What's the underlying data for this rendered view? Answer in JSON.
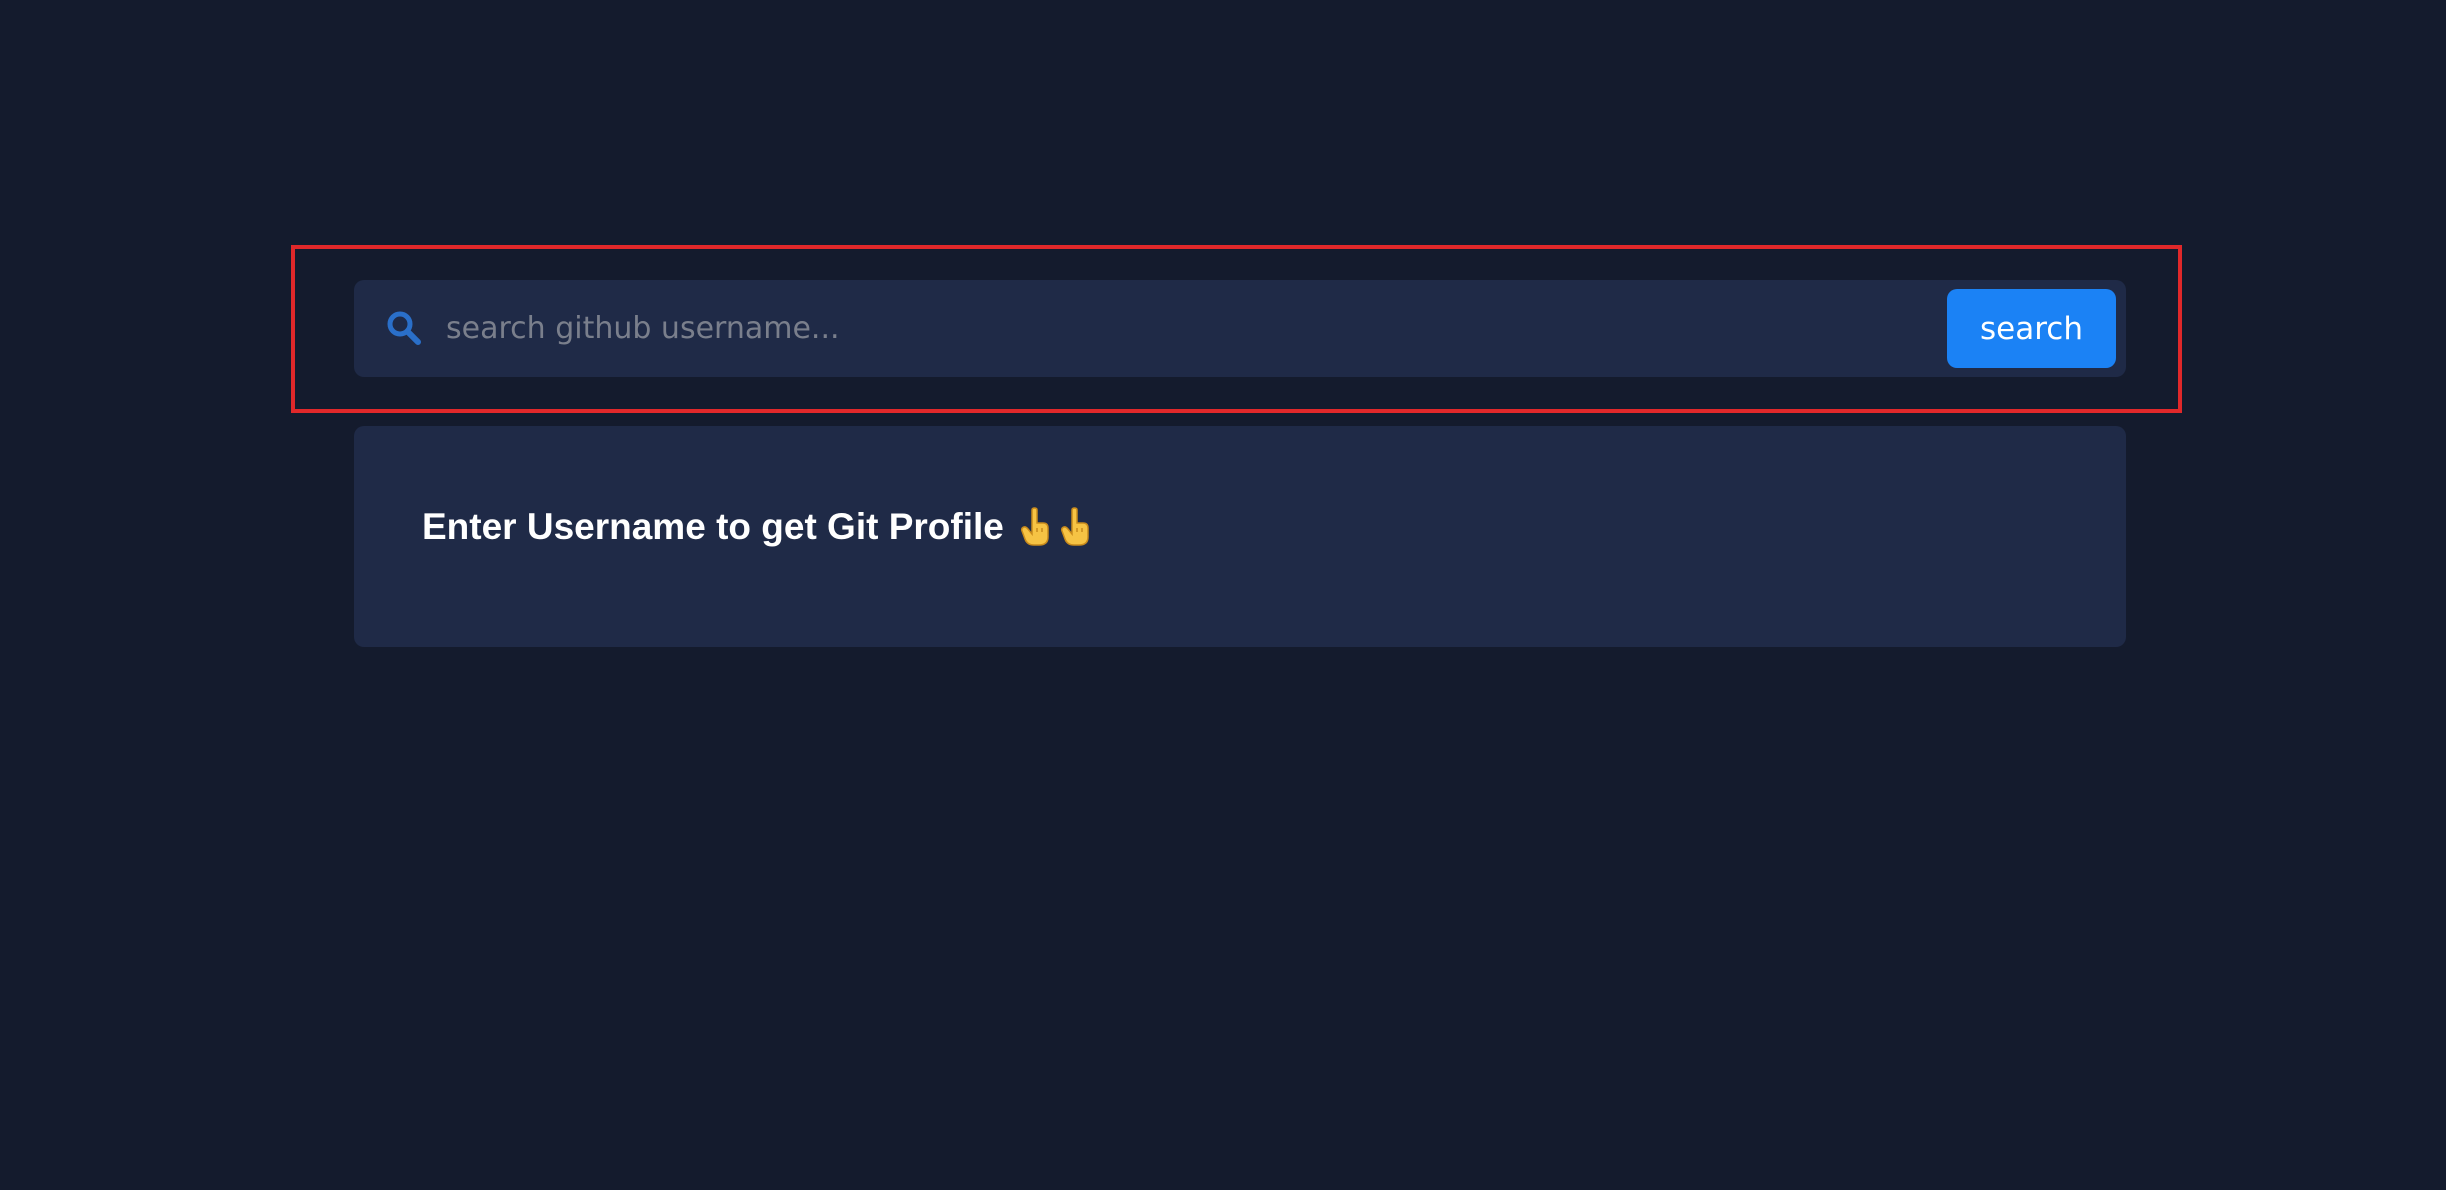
{
  "search": {
    "placeholder": "search github username...",
    "value": "",
    "button_label": "search",
    "icon": "search-icon"
  },
  "result": {
    "message": "Enter Username to get Git Profile",
    "emojis": [
      "pointing-up-icon",
      "pointing-up-icon"
    ]
  },
  "colors": {
    "background": "#141b2d",
    "panel": "#1f2a47",
    "accent": "#1b82f5",
    "highlight": "#e0282a",
    "icon": "#2a6fc9"
  }
}
